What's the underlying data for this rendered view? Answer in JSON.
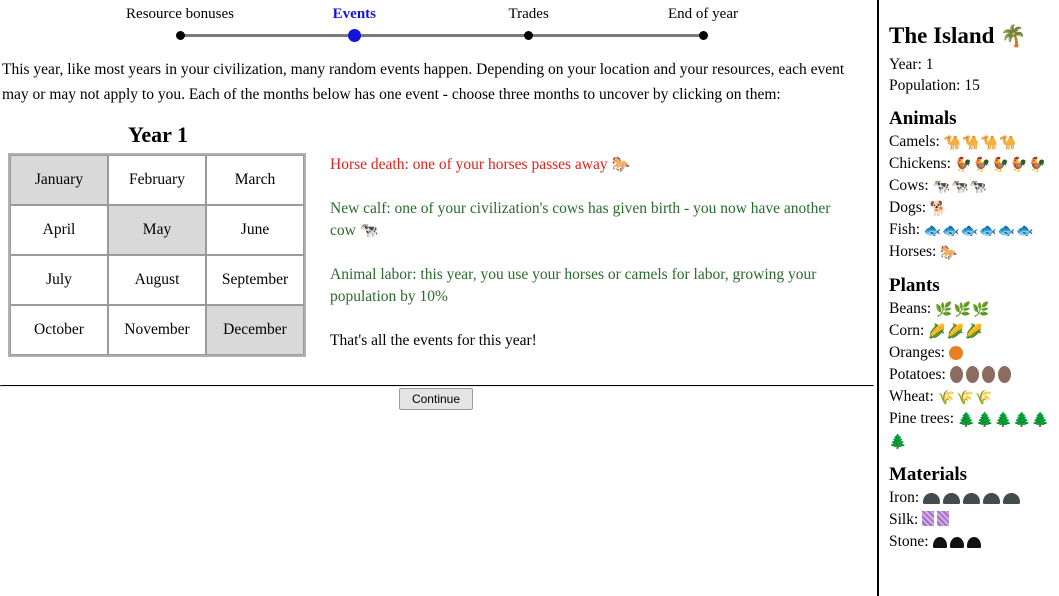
{
  "progress": {
    "steps": [
      {
        "label": "Resource bonuses",
        "current": false
      },
      {
        "label": "Events",
        "current": true
      },
      {
        "label": "Trades",
        "current": false
      },
      {
        "label": "End of year",
        "current": false
      }
    ]
  },
  "intro": {
    "text": "This year, like most years in your civilization, many random events happen. Depending on your location and your resources, each event may or may not apply to you. Each of the months below has one event - choose three months to uncover by clicking on them:"
  },
  "calendar": {
    "heading": "Year 1",
    "months": [
      {
        "name": "January",
        "selected": true
      },
      {
        "name": "February",
        "selected": false
      },
      {
        "name": "March",
        "selected": false
      },
      {
        "name": "April",
        "selected": false
      },
      {
        "name": "May",
        "selected": true
      },
      {
        "name": "June",
        "selected": false
      },
      {
        "name": "July",
        "selected": false
      },
      {
        "name": "August",
        "selected": false
      },
      {
        "name": "September",
        "selected": false
      },
      {
        "name": "October",
        "selected": false
      },
      {
        "name": "November",
        "selected": false
      },
      {
        "name": "December",
        "selected": true
      }
    ]
  },
  "events": [
    {
      "text": "Horse death: one of your horses passes away ",
      "icon": "🐎",
      "icon_name": "horse-icon",
      "color": "red",
      "color_hex": "#e3211a"
    },
    {
      "text": "New calf: one of your civilization's cows has given birth - you now have another cow ",
      "icon": "🐄",
      "icon_name": "cow-icon",
      "color": "green",
      "color_hex": "#2a6b2c"
    },
    {
      "text": "Animal labor: this year, you use your horses or camels for labor, growing your population by 10%",
      "icon": "",
      "icon_name": "",
      "color": "green",
      "color_hex": "#2a6b2c"
    },
    {
      "text": "That's all the events for this year!",
      "icon": "",
      "icon_name": "",
      "color": "black",
      "color_hex": "#000000"
    }
  ],
  "footer": {
    "continue_label": "Continue"
  },
  "sidebar": {
    "title": "The Island",
    "title_icon": "🌴",
    "title_icon_name": "palm-tree-icon",
    "year_line": "Year: 1",
    "population_line": "Population: 15",
    "sections": [
      {
        "heading": "Animals",
        "rows": [
          {
            "label": "Camels:",
            "count": 4,
            "icon": "🐪",
            "icon_name": "camel-icon",
            "style": "glyph"
          },
          {
            "label": "Chickens:",
            "count": 5,
            "icon": "🐓",
            "icon_name": "chicken-icon",
            "style": "glyph"
          },
          {
            "label": "Cows:",
            "count": 3,
            "icon": "🐄",
            "icon_name": "cow-icon",
            "style": "glyph"
          },
          {
            "label": "Dogs:",
            "count": 1,
            "icon": "🐕",
            "icon_name": "dog-icon",
            "style": "glyph"
          },
          {
            "label": "Fish:",
            "count": 6,
            "icon": "🐟",
            "icon_name": "fish-icon",
            "style": "glyph"
          },
          {
            "label": "Horses:",
            "count": 1,
            "icon": "🐎",
            "icon_name": "horse-icon",
            "style": "glyph"
          }
        ]
      },
      {
        "heading": "Plants",
        "rows": [
          {
            "label": "Beans:",
            "count": 3,
            "icon": "🌿",
            "icon_name": "bean-icon",
            "style": "glyph"
          },
          {
            "label": "Corn:",
            "count": 3,
            "icon": "🌽",
            "icon_name": "corn-icon",
            "style": "glyph"
          },
          {
            "label": "Oranges:",
            "count": 1,
            "icon": "🍊",
            "icon_name": "orange-icon",
            "style": "circle-orange"
          },
          {
            "label": "Potatoes:",
            "count": 4,
            "icon": "🥔",
            "icon_name": "potato-icon",
            "style": "oval-potato"
          },
          {
            "label": "Wheat:",
            "count": 3,
            "icon": "🌾",
            "icon_name": "wheat-icon",
            "style": "glyph"
          },
          {
            "label": "Pine trees:",
            "count": 6,
            "icon": "🌲",
            "icon_name": "pine-tree-icon",
            "style": "glyph"
          }
        ]
      },
      {
        "heading": "Materials",
        "rows": [
          {
            "label": "Iron:",
            "count": 5,
            "icon": "",
            "icon_name": "iron-icon",
            "style": "rock-iron"
          },
          {
            "label": "Silk:",
            "count": 2,
            "icon": "",
            "icon_name": "silk-icon",
            "style": "silk-square"
          },
          {
            "label": "Stone:",
            "count": 3,
            "icon": "",
            "icon_name": "stone-icon",
            "style": "rock-stone"
          }
        ]
      }
    ]
  }
}
